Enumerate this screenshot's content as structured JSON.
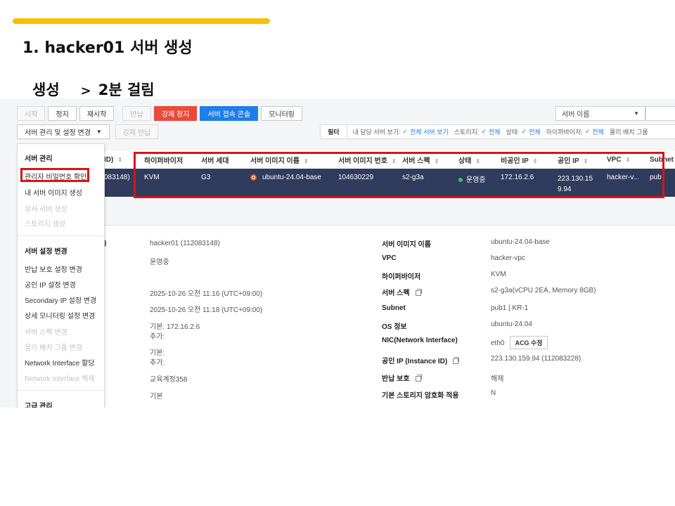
{
  "slide": {
    "title": "1. hacker01 서버 생성",
    "subtitle_left": "생성",
    "subtitle_arrow": ">",
    "subtitle_right": "2분 걸림",
    "accent_color": "#f5c000",
    "highlight_color": "#d8141b"
  },
  "toolbar": {
    "start": "시작",
    "stop": "정지",
    "restart": "재시작",
    "return": "반납",
    "force_stop": "강제 정지",
    "console": "서버 접속 콘솔",
    "monitoring": "모니터링",
    "manage": "서버 관리 및 설정 변경",
    "force_return": "강제 반납",
    "search_select": "서버 이름"
  },
  "filter": {
    "label": "필터",
    "items": [
      {
        "name": "내 담당 서버 보기:",
        "value": "전체 서버 보기"
      },
      {
        "name": "스토리지:",
        "value": "전체"
      },
      {
        "name": "상태:",
        "value": "전체"
      },
      {
        "name": "하이퍼바이저:",
        "value": "전체"
      },
      {
        "name": "물리 배치 그룹",
        "value": ""
      }
    ]
  },
  "table": {
    "partial_id_header": "ID)",
    "headers": [
      "하이퍼바이저",
      "서버 세대",
      "서버 이미지 이름",
      "서버 이미지 번호",
      "서버 스펙",
      "상태",
      "비공인 IP",
      "공인 IP",
      "VPC",
      "Subnet"
    ],
    "row": {
      "id_partial": "083148)",
      "hypervisor": "KVM",
      "generation": "G3",
      "image_name": "ubuntu-24.04-base",
      "image_no": "104630229",
      "spec": "s2-g3a",
      "status": "운영중",
      "private_ip": "172.16.2.6",
      "public_ip_line1": "223.130.15",
      "public_ip_line2": "9.94",
      "vpc": "hacker-v...",
      "subnet": "pub"
    }
  },
  "menu": {
    "section1": "서버 관리",
    "items1": [
      {
        "label": "관리자 비밀번호 확인",
        "disabled": false
      },
      {
        "label": "내 서버 이미지 생성",
        "disabled": false
      },
      {
        "label": "유사 서버 생성",
        "disabled": true
      },
      {
        "label": "스토리지 생성",
        "disabled": true
      }
    ],
    "section2": "서버 설정 변경",
    "items2": [
      {
        "label": "반납 보호 설정 변경",
        "disabled": false
      },
      {
        "label": "공인 IP 설정 변경",
        "disabled": false
      },
      {
        "label": "Secondary IP 설정 변경",
        "disabled": false
      },
      {
        "label": "상세 모니터링 설정 변경",
        "disabled": false
      },
      {
        "label": "서버 스펙 변경",
        "disabled": true
      },
      {
        "label": "물리 배치 그룹 변경",
        "disabled": true
      },
      {
        "label": "Network Interface 할당",
        "disabled": false
      },
      {
        "label": "Network Interface 해제",
        "disabled": true
      }
    ],
    "section3": "고급 관리"
  },
  "detail": {
    "left_partial_label": ")",
    "left_values": [
      "hacker01 (112083148)",
      "운영중",
      "2025-10-26 오전 11:16 (UTC+09:00)",
      "2025-10-26 오전 11:18 (UTC+09:00)",
      "기본: 172.16.2.6",
      "추가:",
      "기본:",
      "추가:",
      "교육계정358",
      "기본"
    ],
    "right_labels": [
      "서버 이미지 이름",
      "VPC",
      "하이퍼바이저",
      "서버 스펙",
      "Subnet",
      "OS 정보",
      "NIC(Network Interface)",
      "공인 IP (Instance ID)",
      "반납 보호",
      "기본 스토리지 암호화 적용"
    ],
    "right_values": [
      "ubuntu-24.04-base",
      "hacker-vpc",
      "KVM",
      "s2-g3a(vCPU 2EA, Memory 8GB)",
      "pub1 | KR-1",
      "ubuntu-24.04",
      "eth0",
      "223.130.159.94 (112083228)",
      "해제",
      "N"
    ],
    "acg_button": "ACG 수정"
  }
}
